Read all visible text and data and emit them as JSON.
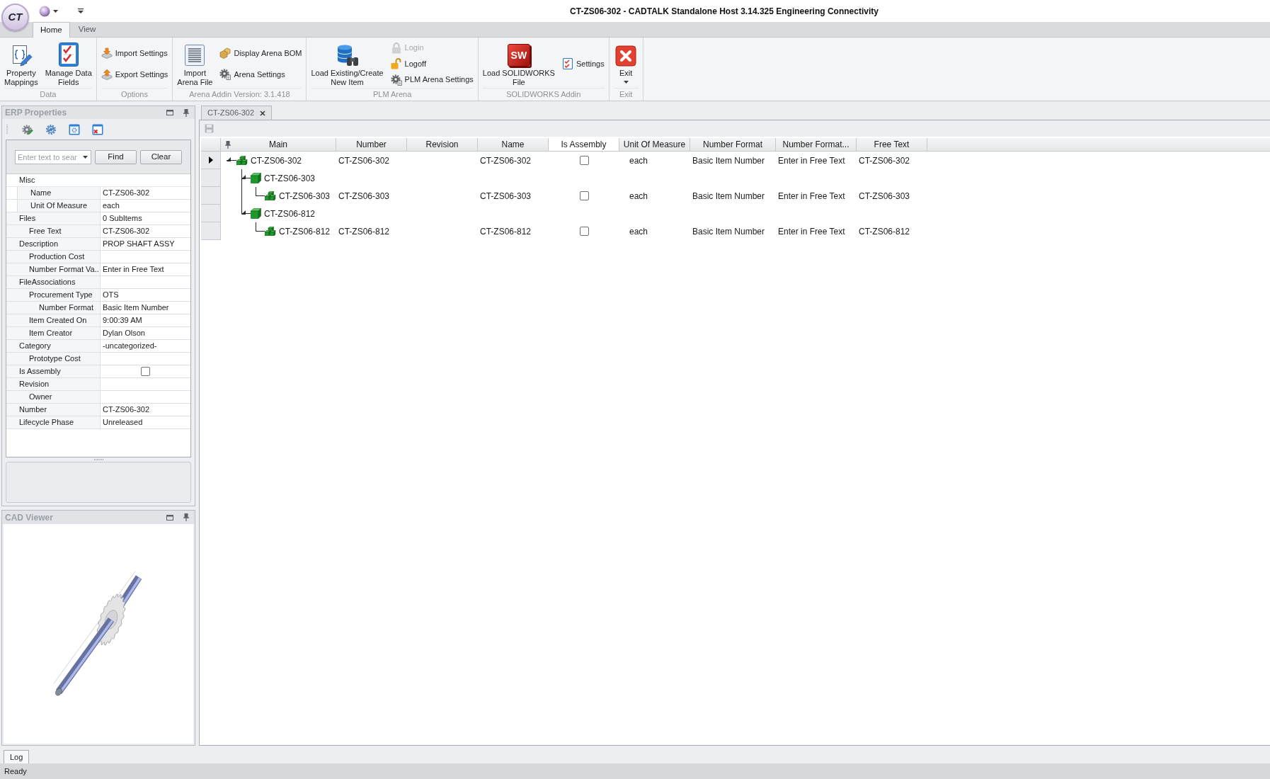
{
  "window": {
    "title": "CT-ZS06-302 - CADTALK Standalone Host 3.14.325 Engineering Connectivity"
  },
  "app_button": {
    "label": "CT"
  },
  "ribbon": {
    "tabs": [
      {
        "label": "Home",
        "selected": true
      },
      {
        "label": "View",
        "selected": false
      }
    ],
    "groups": [
      {
        "label": "Data",
        "items": [
          {
            "kind": "large",
            "label": "Property\nMappings",
            "disabled": false
          },
          {
            "kind": "large",
            "label": "Manage Data\nFields",
            "disabled": false
          }
        ]
      },
      {
        "label": "Options",
        "items": [
          {
            "kind": "small",
            "label": "Import Settings",
            "disabled": false
          },
          {
            "kind": "small",
            "label": "Export Settings",
            "disabled": false
          }
        ]
      },
      {
        "label": "Arena Addin Version: 3.1.418",
        "items": [
          {
            "kind": "large",
            "label": "Import\nArena File",
            "disabled": false
          },
          {
            "kind": "small",
            "label": "Display Arena BOM",
            "disabled": false
          },
          {
            "kind": "small",
            "label": "Arena Settings",
            "disabled": false
          }
        ]
      },
      {
        "label": "PLM Arena",
        "items": [
          {
            "kind": "large",
            "label": "Load Existing/Create\nNew Item",
            "disabled": false
          },
          {
            "kind": "small",
            "label": "Login",
            "disabled": true
          },
          {
            "kind": "small",
            "label": "Logoff",
            "disabled": false
          },
          {
            "kind": "small",
            "label": "PLM Arena Settings",
            "disabled": false
          }
        ]
      },
      {
        "label": "SOLIDWORKS Addin",
        "items": [
          {
            "kind": "large",
            "label": "Load SOLIDWORKS\nFile",
            "logo_text": "SW",
            "disabled": false
          },
          {
            "kind": "small",
            "label": "Settings",
            "disabled": false
          }
        ]
      },
      {
        "label": "Exit",
        "items": [
          {
            "kind": "dropdown",
            "label": "Exit",
            "disabled": false
          }
        ]
      }
    ]
  },
  "erp_panel": {
    "title": "ERP Properties",
    "search": {
      "placeholder": "Enter text to sear"
    },
    "buttons": [
      "Find",
      "Clear"
    ],
    "properties": [
      {
        "kind": "category",
        "label": "Misc",
        "children": [
          {
            "kind": "text",
            "label": "Name",
            "value": "CT-ZS06-302"
          },
          {
            "kind": "text",
            "label": "Unit Of Measure",
            "value": "each"
          }
        ]
      },
      {
        "kind": "text",
        "label": "Files",
        "value": "0 SubItems",
        "children": [
          {
            "kind": "text",
            "label": "Free Text",
            "value": "CT-ZS06-302"
          }
        ]
      },
      {
        "kind": "text",
        "label": "Description",
        "value": "PROP SHAFT ASSY",
        "children": [
          {
            "kind": "text",
            "label": "Production Cost"
          },
          {
            "kind": "text",
            "label": "Number Format Va..",
            "value": "Enter in Free Text"
          }
        ]
      },
      {
        "kind": "text",
        "label": "FileAssociations",
        "children": [
          {
            "kind": "text",
            "label": "Procurement Type",
            "value": "OTS",
            "children": [
              {
                "kind": "text",
                "label": "Number Format",
                "value": "Basic Item Number"
              }
            ]
          },
          {
            "kind": "text",
            "label": "Item Created On",
            "value": "9:00:39 AM"
          },
          {
            "kind": "text",
            "label": "Item Creator",
            "value": "Dylan Olson"
          }
        ]
      },
      {
        "kind": "text",
        "label": "Category",
        "value": "-uncategorized-",
        "children": [
          {
            "kind": "text",
            "label": "Prototype Cost"
          }
        ]
      },
      {
        "kind": "checkbox",
        "label": "Is Assembly",
        "checked": false
      },
      {
        "kind": "text",
        "label": "Revision",
        "children": [
          {
            "kind": "text",
            "label": "Owner"
          }
        ]
      },
      {
        "kind": "text",
        "label": "Number",
        "value": "CT-ZS06-302"
      },
      {
        "kind": "text",
        "label": "Lifecycle Phase",
        "value": "Unreleased"
      }
    ]
  },
  "cad_viewer": {
    "title": "CAD Viewer"
  },
  "document_tabs": [
    {
      "label": "CT-ZS06-302",
      "selected": true
    }
  ],
  "grid": {
    "columns": [
      {
        "label": "Main",
        "highlighted": false
      },
      {
        "label": "Number",
        "highlighted": false
      },
      {
        "label": "Revision",
        "highlighted": false
      },
      {
        "label": "Name",
        "highlighted": false
      },
      {
        "label": "Is Assembly",
        "highlighted": true
      },
      {
        "label": "Unit Of Measure",
        "highlighted": false
      },
      {
        "label": "Number Format",
        "highlighted": false
      },
      {
        "label": "Number Format...",
        "highlighted": false
      },
      {
        "label": "Free Text",
        "highlighted": false
      }
    ],
    "rows": [
      {
        "kind": "item",
        "selected": true,
        "expanded": true,
        "main": "CT-ZS06-302",
        "number": "CT-ZS06-302",
        "name": "CT-ZS06-302",
        "is_assembly": false,
        "unit_of_measure": "each",
        "number_format": "Basic Item Number",
        "column_8": "Enter in Free Text",
        "free_text": "CT-ZS06-302",
        "children": [
          {
            "kind": "group",
            "selected": false,
            "expanded": true,
            "main": "CT-ZS06-303",
            "children": [
              {
                "kind": "item",
                "selected": false,
                "main": "CT-ZS06-303",
                "number": "CT-ZS06-303",
                "name": "CT-ZS06-303",
                "is_assembly": false,
                "unit_of_measure": "each",
                "number_format": "Basic Item Number",
                "column_8": "Enter in Free Text",
                "free_text": "CT-ZS06-303"
              }
            ]
          },
          {
            "kind": "group",
            "selected": false,
            "expanded": true,
            "main": "CT-ZS06-812",
            "children": [
              {
                "kind": "item",
                "selected": false,
                "main": "CT-ZS06-812",
                "number": "CT-ZS06-812",
                "name": "CT-ZS06-812",
                "is_assembly": false,
                "unit_of_measure": "each",
                "number_format": "Basic Item Number",
                "column_8": "Enter in Free Text",
                "free_text": "CT-ZS06-812"
              }
            ]
          }
        ]
      }
    ]
  },
  "log_tab": {
    "label": "Log"
  },
  "status_bar": {
    "text": "Ready"
  }
}
